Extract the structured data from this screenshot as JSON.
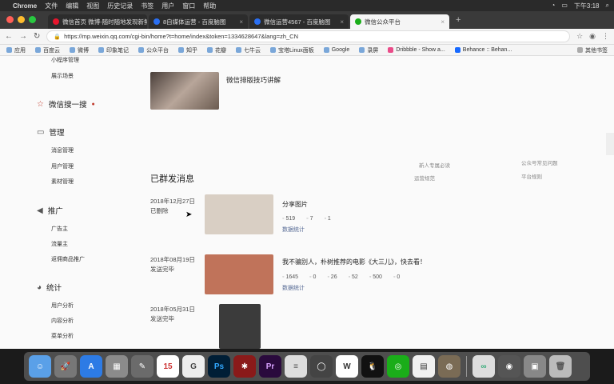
{
  "menubar": {
    "app": "Chrome",
    "items": [
      "文件",
      "编辑",
      "视图",
      "历史记录",
      "书签",
      "用户",
      "窗口",
      "帮助"
    ],
    "clock": "下午3:18"
  },
  "tabs": [
    {
      "label": "微信首页 微博-随时随地发现新鲜",
      "active": true
    },
    {
      "label": "8自媒体运营 - 百度脑图",
      "active": false
    },
    {
      "label": "微信运营4567 - 百度脑图",
      "active": false
    },
    {
      "label": "微信公众平台",
      "active": false
    }
  ],
  "address": {
    "url": "https://mp.weixin.qq.com/cgi-bin/home?t=home/index&token=1334628647&lang=zh_CN"
  },
  "bookmarks": {
    "items": [
      "应用",
      "百度云",
      "微博",
      "印象笔记",
      "公众平台",
      "知乎",
      "花瓣",
      "七牛云",
      "宝塔Linux面板",
      "Google",
      "录屏",
      "Dribbble - Show a...",
      "Behance :: Behan..."
    ],
    "other": "其他书签"
  },
  "sidebar": {
    "top_items": [
      "小程序管理",
      "展示场景"
    ],
    "search": {
      "label": "微信搜一搜"
    },
    "manage": {
      "label": "管理",
      "items": [
        "消息管理",
        "用户管理",
        "素材管理"
      ]
    },
    "promote": {
      "label": "推广",
      "items": [
        "广告主",
        "流量主",
        "返佣商品推广"
      ]
    },
    "stats": {
      "label": "统计",
      "items": [
        "用户分析",
        "内容分析",
        "菜单分析"
      ]
    }
  },
  "main": {
    "banner_title": "微信排版技巧讲解",
    "section_title": "已群发消息",
    "right_hints": [
      "新人专属必读",
      "公众号常见问题",
      "运营规范",
      "平台规则"
    ],
    "messages": [
      {
        "date": "2018年12月27日",
        "status": "已删除",
        "title": "分享图片",
        "stats": [
          "519",
          "7",
          "1"
        ],
        "link": "数据统计",
        "thumb": "#d9cfc4"
      },
      {
        "date": "2018年08月19日",
        "status": "发送完毕",
        "title": "我不骗别人，朴树推荐的电影《大三儿》，快去看！",
        "stats": [
          "1645",
          "0",
          "26",
          "52",
          "500",
          "0"
        ],
        "link": "数据统计",
        "thumb": "#c0735a"
      },
      {
        "date": "2018年05月31日",
        "status": "发送完毕",
        "title": "",
        "stats": [],
        "link": "",
        "thumb": "#3b3b3b"
      }
    ]
  },
  "colors": {
    "wechat_green": "#1aad19",
    "link_blue": "#576b95",
    "accent_red": "#c0392b"
  }
}
